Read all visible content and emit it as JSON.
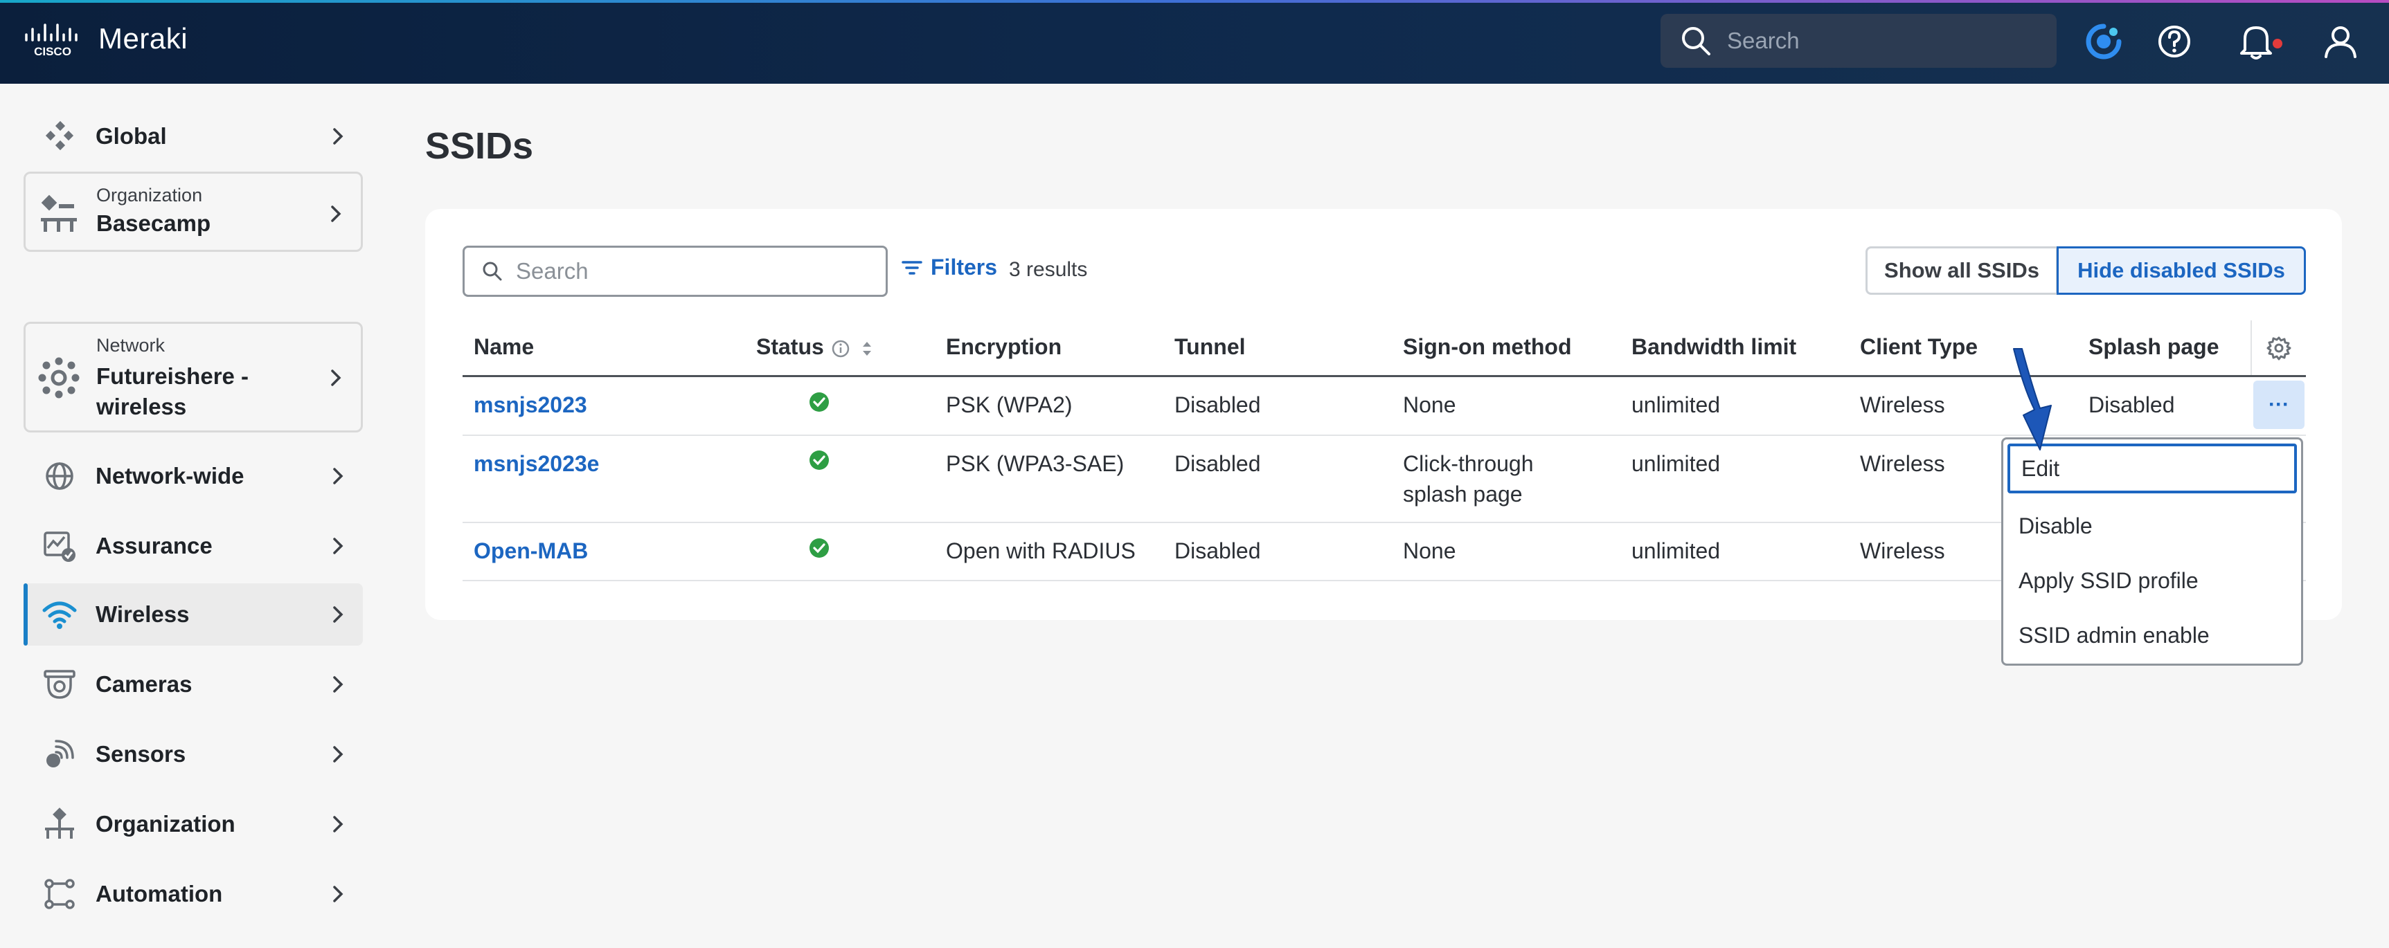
{
  "header": {
    "brand_name": "Meraki",
    "search_placeholder": "Search"
  },
  "sidebar": {
    "global_label": "Global",
    "organization_card": {
      "label": "Organization",
      "value": "Basecamp"
    },
    "network_card": {
      "label": "Network",
      "value_line1": "Futureishere -",
      "value_line2": "wireless"
    },
    "items": [
      {
        "label": "Network-wide"
      },
      {
        "label": "Assurance"
      },
      {
        "label": "Wireless"
      },
      {
        "label": "Cameras"
      },
      {
        "label": "Sensors"
      },
      {
        "label": "Organization"
      },
      {
        "label": "Automation"
      }
    ]
  },
  "main": {
    "title": "SSIDs",
    "search_placeholder": "Search",
    "filters_label": "Filters",
    "results_text": "3 results",
    "toggle": {
      "show_all": "Show all SSIDs",
      "hide_disabled": "Hide disabled SSIDs"
    },
    "table": {
      "columns": [
        "Name",
        "Status",
        "Encryption",
        "Tunnel",
        "Sign-on method",
        "Bandwidth limit",
        "Client Type",
        "Splash page"
      ],
      "rows": [
        {
          "name": "msnjs2023",
          "encryption": "PSK (WPA2)",
          "tunnel": "Disabled",
          "signon_line1": "None",
          "signon_line2": "",
          "bandwidth": "unlimited",
          "client_type": "Wireless",
          "splash": "Disabled"
        },
        {
          "name": "msnjs2023e",
          "encryption": "PSK (WPA3-SAE)",
          "tunnel": "Disabled",
          "signon_line1": "Click-through",
          "signon_line2": "splash page",
          "bandwidth": "unlimited",
          "client_type": "Wireless",
          "splash": ""
        },
        {
          "name": "Open-MAB",
          "encryption": "Open with RADIUS",
          "tunnel": "Disabled",
          "signon_line1": "None",
          "signon_line2": "",
          "bandwidth": "unlimited",
          "client_type": "Wireless",
          "splash": ""
        }
      ]
    },
    "more_label": "···",
    "row_menu": [
      "Edit",
      "Disable",
      "Apply SSID profile",
      "SSID admin enable"
    ]
  },
  "colors": {
    "accent": "#1c66c1",
    "status_ok": "#2e9e44",
    "topbar": "#0f2a4d"
  }
}
